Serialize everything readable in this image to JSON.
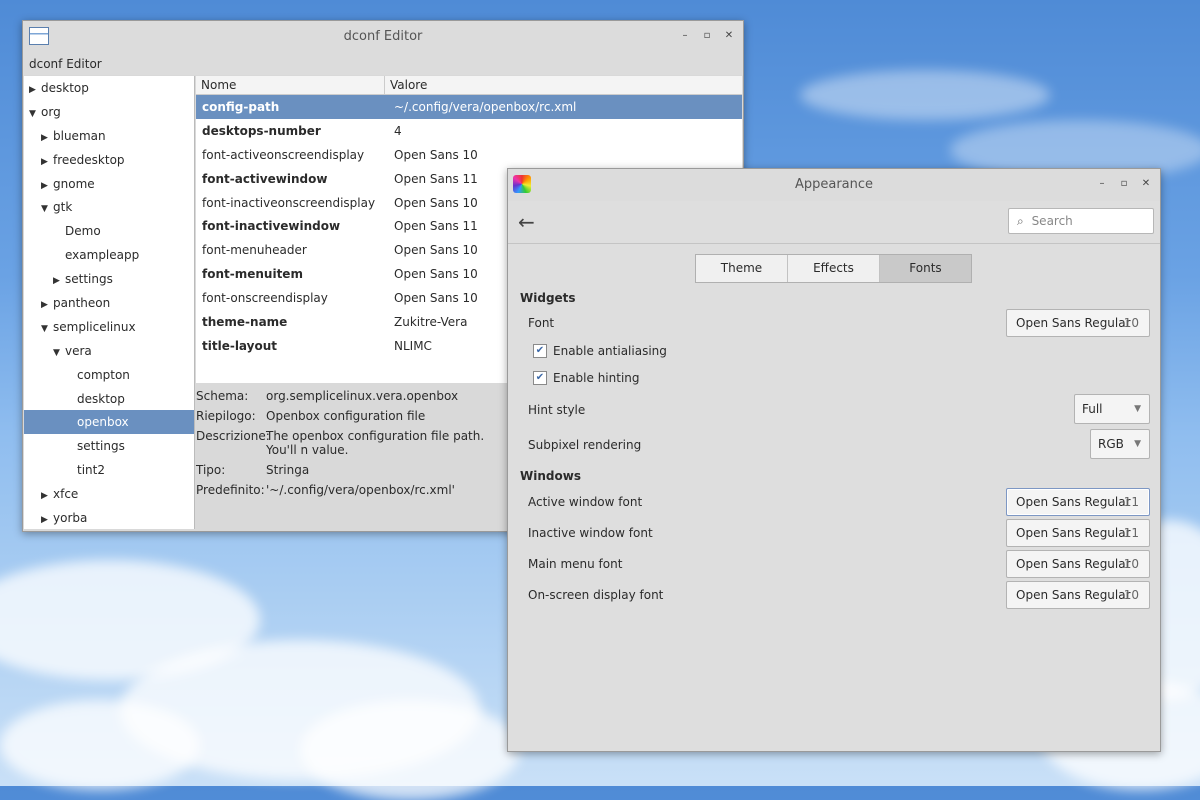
{
  "dconf": {
    "window_title": "dconf Editor",
    "menu_label": "dconf Editor",
    "window_buttons": {
      "minimize": "–",
      "maximize": "▫",
      "close": "✕"
    },
    "tree": [
      {
        "label": "desktop",
        "depth": 0,
        "arrow": "▶"
      },
      {
        "label": "org",
        "depth": 0,
        "arrow": "▼"
      },
      {
        "label": "blueman",
        "depth": 1,
        "arrow": "▶"
      },
      {
        "label": "freedesktop",
        "depth": 1,
        "arrow": "▶"
      },
      {
        "label": "gnome",
        "depth": 1,
        "arrow": "▶"
      },
      {
        "label": "gtk",
        "depth": 1,
        "arrow": "▼"
      },
      {
        "label": "Demo",
        "depth": 2,
        "arrow": ""
      },
      {
        "label": "exampleapp",
        "depth": 2,
        "arrow": ""
      },
      {
        "label": "settings",
        "depth": 2,
        "arrow": "▶"
      },
      {
        "label": "pantheon",
        "depth": 1,
        "arrow": "▶"
      },
      {
        "label": "semplicelinux",
        "depth": 1,
        "arrow": "▼"
      },
      {
        "label": "vera",
        "depth": 2,
        "arrow": "▼"
      },
      {
        "label": "compton",
        "depth": 3,
        "arrow": ""
      },
      {
        "label": "desktop",
        "depth": 3,
        "arrow": ""
      },
      {
        "label": "openbox",
        "depth": 3,
        "arrow": "",
        "selected": true
      },
      {
        "label": "settings",
        "depth": 3,
        "arrow": ""
      },
      {
        "label": "tint2",
        "depth": 3,
        "arrow": ""
      },
      {
        "label": "xfce",
        "depth": 1,
        "arrow": "▶"
      },
      {
        "label": "yorba",
        "depth": 1,
        "arrow": "▶"
      }
    ],
    "columns": {
      "name": "Nome",
      "value": "Valore"
    },
    "rows": [
      {
        "key": "config-path",
        "value": "~/.config/vera/openbox/rc.xml",
        "bold": true,
        "selected": true
      },
      {
        "key": "desktops-number",
        "value": "4",
        "bold": true
      },
      {
        "key": "font-activeonscreendisplay",
        "value": "Open Sans 10",
        "bold": false
      },
      {
        "key": "font-activewindow",
        "value": "Open Sans 11",
        "bold": true
      },
      {
        "key": "font-inactiveonscreendisplay",
        "value": "Open Sans 10",
        "bold": false
      },
      {
        "key": "font-inactivewindow",
        "value": "Open Sans 11",
        "bold": true
      },
      {
        "key": "font-menuheader",
        "value": "Open Sans 10",
        "bold": false
      },
      {
        "key": "font-menuitem",
        "value": "Open Sans 10",
        "bold": true
      },
      {
        "key": "font-onscreendisplay",
        "value": "Open Sans 10",
        "bold": false
      },
      {
        "key": "theme-name",
        "value": "Zukitre-Vera",
        "bold": true
      },
      {
        "key": "title-layout",
        "value": "NLIMC",
        "bold": true
      }
    ],
    "details": {
      "schema_label": "Schema:",
      "schema": "org.semplicelinux.vera.openbox",
      "summary_label": "Riepilogo:",
      "summary": "Openbox configuration file",
      "description_label": "Descrizione:",
      "description": "The openbox configuration file path. You'll n value.",
      "type_label": "Tipo:",
      "type": "Stringa",
      "default_label": "Predefinito:",
      "default": "'~/.config/vera/openbox/rc.xml'"
    }
  },
  "appearance": {
    "window_title": "Appearance",
    "window_buttons": {
      "minimize": "–",
      "maximize": "▫",
      "close": "✕"
    },
    "back_icon": "←",
    "search_placeholder": "Search",
    "tabs": [
      "Theme",
      "Effects",
      "Fonts"
    ],
    "active_tab": "Fonts",
    "widgets_heading": "Widgets",
    "font_label": "Font",
    "font_value": {
      "name": "Open Sans Regular",
      "size": "10"
    },
    "antialiasing_label": "Enable antialiasing",
    "antialiasing_checked": true,
    "hinting_label": "Enable hinting",
    "hinting_checked": true,
    "hint_style_label": "Hint style",
    "hint_style_value": "Full",
    "subpixel_label": "Subpixel rendering",
    "subpixel_value": "RGB",
    "windows_heading": "Windows",
    "window_fonts": [
      {
        "label": "Active window font",
        "name": "Open Sans Regular",
        "size": "11"
      },
      {
        "label": "Inactive window font",
        "name": "Open Sans Regular",
        "size": "11"
      },
      {
        "label": "Main menu font",
        "name": "Open Sans Regular",
        "size": "10"
      },
      {
        "label": "On-screen display font",
        "name": "Open Sans Regular",
        "size": "10"
      }
    ]
  }
}
